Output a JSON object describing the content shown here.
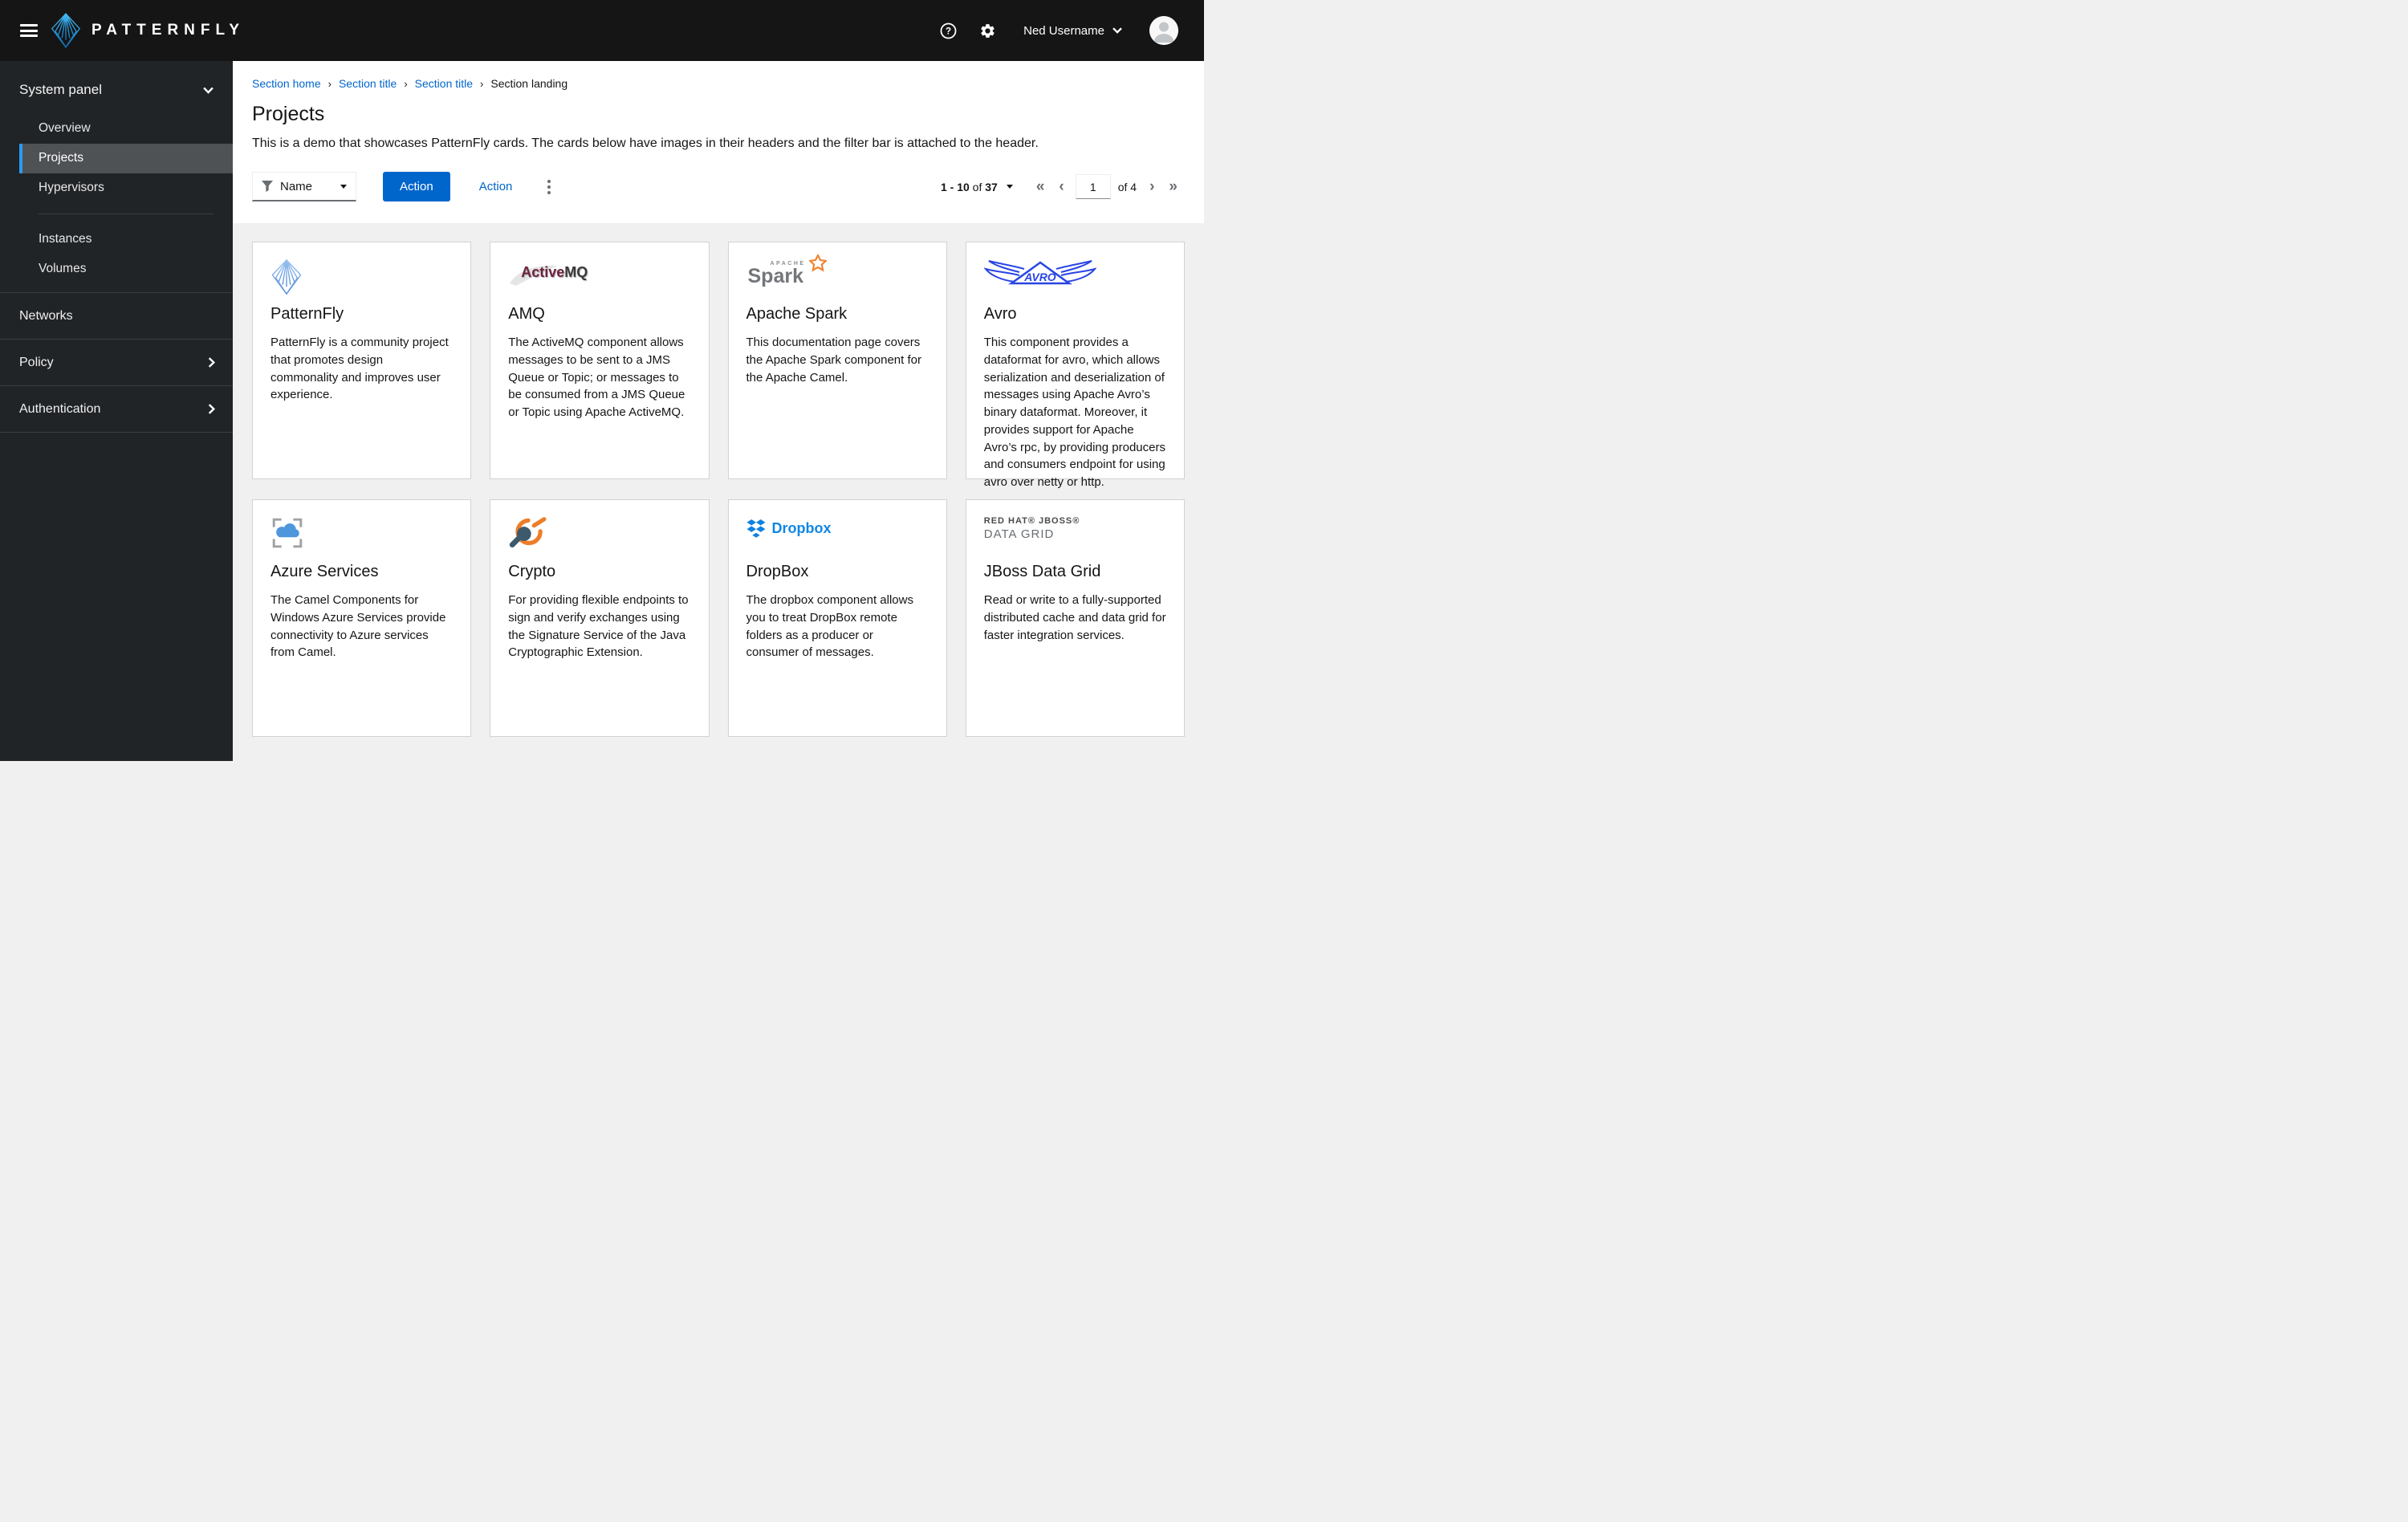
{
  "masthead": {
    "brand": "PATTERNFLY",
    "username": "Ned Username"
  },
  "sidebar": {
    "section_label": "System panel",
    "group1": [
      {
        "label": "Overview",
        "active": false
      },
      {
        "label": "Projects",
        "active": true
      },
      {
        "label": "Hypervisors",
        "active": false
      }
    ],
    "group2": [
      {
        "label": "Instances",
        "active": false
      },
      {
        "label": "Volumes",
        "active": false
      }
    ],
    "top_items": [
      {
        "label": "Networks",
        "expandable": false
      },
      {
        "label": "Policy",
        "expandable": true
      },
      {
        "label": "Authentication",
        "expandable": true
      }
    ]
  },
  "breadcrumb": {
    "items": [
      "Section home",
      "Section title",
      "Section title"
    ],
    "current": "Section landing"
  },
  "page": {
    "title": "Projects",
    "description": "This is a demo that showcases PatternFly cards. The cards below have images in their headers and the filter bar is attached to the header."
  },
  "toolbar": {
    "filter_label": "Name",
    "primary_action": "Action",
    "secondary_action": "Action"
  },
  "pagination": {
    "range_start": "1 - 10",
    "of_word": "of",
    "total": "37",
    "current_page": "1",
    "pages_label": "of 4"
  },
  "cards": [
    {
      "title": "PatternFly",
      "body": "PatternFly is a community project that promotes design commonality and improves user experience."
    },
    {
      "title": "AMQ",
      "logo": {
        "part1": "Active",
        "part2": "MQ"
      },
      "body": "The ActiveMQ component allows messages to be sent to a JMS Queue or Topic; or messages to be consumed from a JMS Queue or Topic using Apache ActiveMQ."
    },
    {
      "title": "Apache Spark",
      "logo": {
        "top": "APACHE",
        "text": "Spark"
      },
      "body": "This documentation page covers the Apache Spark component for the Apache Camel."
    },
    {
      "title": "Avro",
      "logo": {
        "text": "AVRO"
      },
      "body": "This component provides a dataformat for avro, which allows serialization and deserialization of messages using Apache Avro’s binary dataformat. Moreover, it provides support for Apache Avro’s rpc, by providing producers and consumers endpoint for using avro over netty or http."
    },
    {
      "title": "Azure Services",
      "body": "The Camel Components for Windows Azure Services provide connectivity to Azure services from Camel."
    },
    {
      "title": "Crypto",
      "body": "For providing flexible endpoints to sign and verify exchanges using the Signature Service of the Java Cryptographic Extension."
    },
    {
      "title": "DropBox",
      "logo": {
        "text": "Dropbox"
      },
      "body": "The dropbox component allows you to treat DropBox remote folders as a producer or consumer of messages."
    },
    {
      "title": "JBoss Data Grid",
      "logo": {
        "line1": "RED HAT® JBOSS®",
        "line2": "DATA GRID"
      },
      "body": "Read or write to a fully-supported distributed cache and data grid for faster integration services."
    }
  ],
  "colors": {
    "masthead_bg": "#151515",
    "sidebar_bg": "#212427",
    "nav_active_bg": "#4f5255",
    "nav_accent": "#2b9af3",
    "primary_blue": "#0066cc",
    "page_bg": "#f0f0f0"
  }
}
